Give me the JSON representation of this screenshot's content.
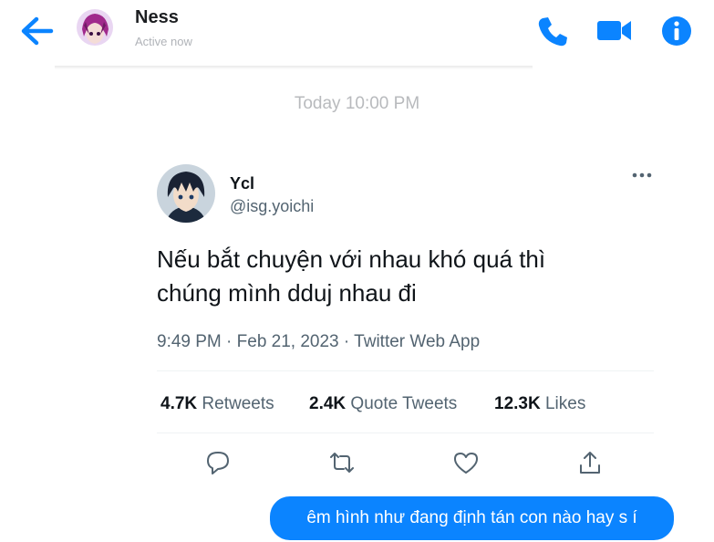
{
  "header": {
    "contact_name": "Ness",
    "status": "Active now",
    "icons": [
      "back-arrow-icon",
      "phone-icon",
      "video-camera-icon",
      "info-icon"
    ],
    "accent_color": "#0b84ff"
  },
  "chat": {
    "timestamp": "Today 10:00 PM",
    "outgoing_message": "êm hình như đang định tán con nào hay s í"
  },
  "tweet": {
    "display_name": "Ycl",
    "handle": "@isg.yoichi",
    "text_line1": "Nếu bắt chuyện với nhau khó quá thì",
    "text_line2": "chúng mình dduj nhau đi",
    "meta": "9:49 PM · Feb 21, 2023 · Twitter Web App",
    "stats": {
      "retweets_count": "4.7K",
      "retweets_label": "Retweets",
      "quotes_count": "2.4K",
      "quotes_label": "Quote Tweets",
      "likes_count": "12.3K",
      "likes_label": "Likes"
    },
    "actions": [
      "reply-icon",
      "retweet-icon",
      "like-icon",
      "share-icon"
    ]
  }
}
